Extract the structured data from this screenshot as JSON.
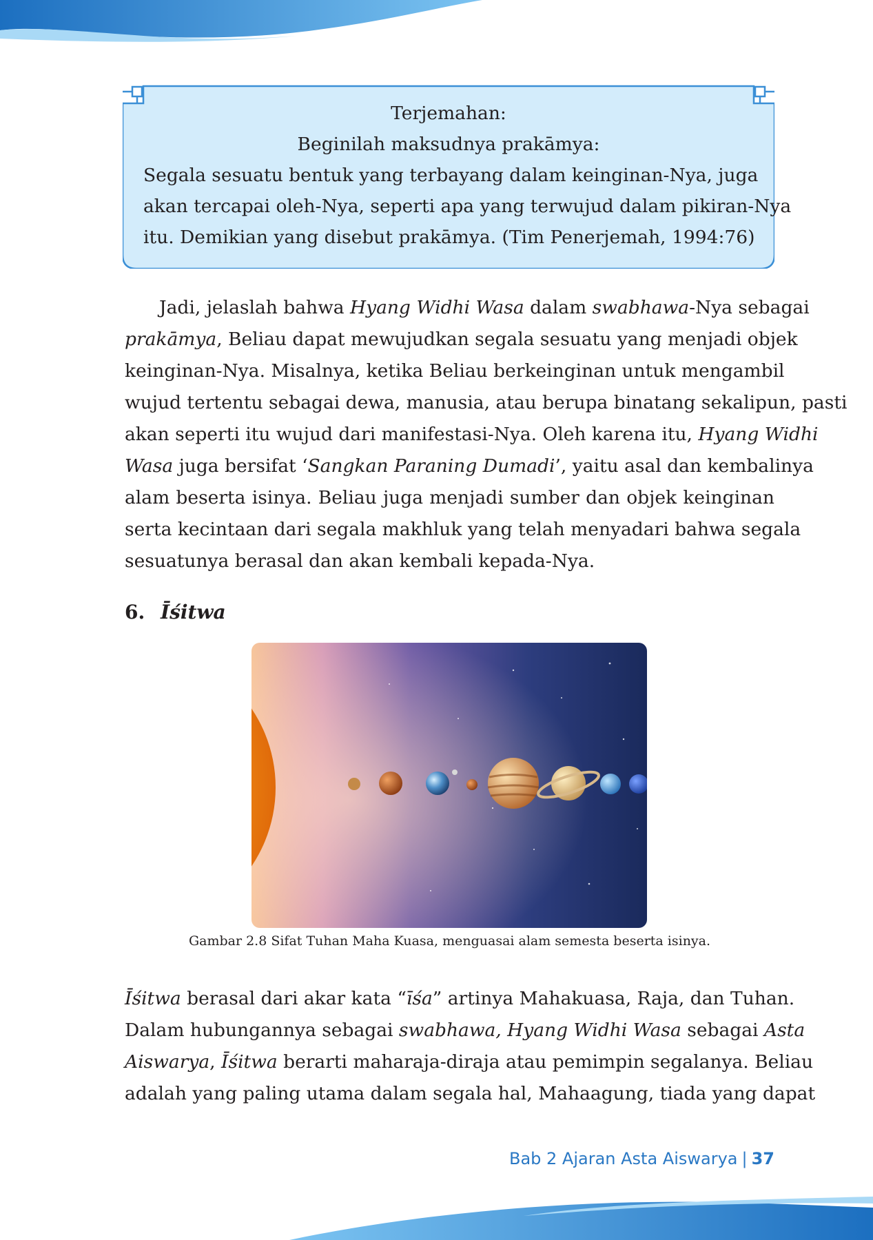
{
  "translation_box": {
    "title": "Terjemahan:",
    "lines": [
      "Beginilah maksudnya prakāmya:",
      "Segala sesuatu bentuk yang terbayang dalam keinginan-Nya, juga",
      "akan tercapai oleh-Nya, seperti apa yang terwujud dalam pikiran-Nya",
      "itu. Demikian yang disebut prakāmya. (Tim Penerjemah, 1994:76)"
    ]
  },
  "paragraph1": {
    "l1_a": "Jadi, jelaslah bahwa ",
    "l1_b": "Hyang Widhi Wasa",
    "l1_c": " dalam ",
    "l1_d": "swabhawa",
    "l1_e": "-Nya sebagai",
    "l2_a": "prakāmya",
    "l2_b": ", Beliau dapat mewujudkan segala sesuatu yang menjadi objek",
    "l3": "keinginan-Nya. Misalnya, ketika Beliau berkeinginan untuk mengambil",
    "l4": "wujud tertentu sebagai dewa, manusia, atau berupa binatang sekalipun, pasti",
    "l5_a": "akan seperti itu wujud dari manifestasi-Nya. Oleh karena itu, ",
    "l5_b": "Hyang Widhi",
    "l6_a": "Wasa",
    "l6_b": " juga bersifat ‘",
    "l6_c": "Sangkan Paraning Dumadi",
    "l6_d": "’, yaitu asal dan kembalinya",
    "l7": "alam beserta isinya. Beliau juga menjadi sumber dan objek keinginan",
    "l8": "serta kecintaan dari segala makhluk yang telah menyadari bahwa segala",
    "l9": "sesuatunya berasal dan akan kembali kepada-Nya."
  },
  "section": {
    "number": "6.",
    "title": "Īśitwa"
  },
  "figure": {
    "caption": "Gambar 2.8 Sifat Tuhan Maha Kuasa, menguasai alam semesta beserta isinya."
  },
  "paragraph2": {
    "l1_a": "Īśitwa",
    "l1_b": " berasal dari akar kata “",
    "l1_c": "īśa",
    "l1_d": "” artinya Mahakuasa, Raja, dan Tuhan.",
    "l2_a": "Dalam hubungannya sebagai ",
    "l2_b": "swabhawa, Hyang Widhi Wasa",
    "l2_c": " sebagai ",
    "l2_d": "Asta",
    "l3_a": "Aiswarya",
    "l3_b": ", ",
    "l3_c": "Īśitwa",
    "l3_d": " berarti maharaja-diraja atau pemimpin segalanya. Beliau",
    "l4": "adalah yang paling utama dalam segala hal, Mahaagung, tiada yang dapat"
  },
  "footer": {
    "chapter": "Bab 2 Ajaran Asta Aiswarya",
    "separator": "|",
    "page": "37"
  },
  "colors": {
    "accent_blue": "#2a78c4",
    "box_fill": "#d3ecfb",
    "box_border": "#3b8fd6"
  }
}
